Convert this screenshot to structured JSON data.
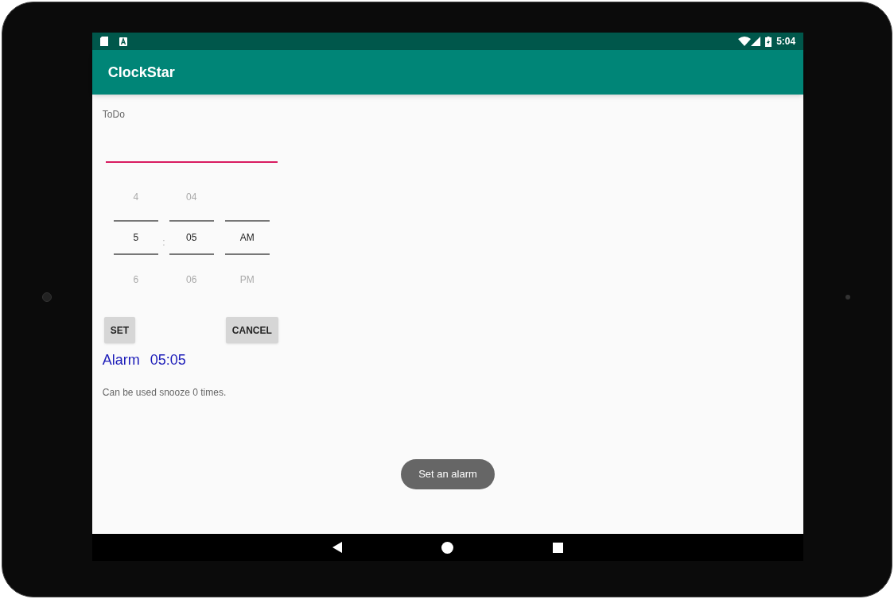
{
  "status_bar": {
    "time": "5:04"
  },
  "app_bar": {
    "title": "ClockStar"
  },
  "todo": {
    "label": "ToDo",
    "focused": true
  },
  "time_picker": {
    "columns": [
      {
        "above": "4",
        "current": "5",
        "below": "6",
        "separator_after": ":"
      },
      {
        "above": "04",
        "current": "05",
        "below": "06"
      },
      {
        "current": "AM",
        "below": "PM"
      }
    ]
  },
  "buttons": [
    "SET",
    "CANCEL"
  ],
  "alarm": {
    "label": "Alarm",
    "time": "05:05"
  },
  "snooze_text": "Can be used snooze 0 times.",
  "toast": "Set an alarm"
}
